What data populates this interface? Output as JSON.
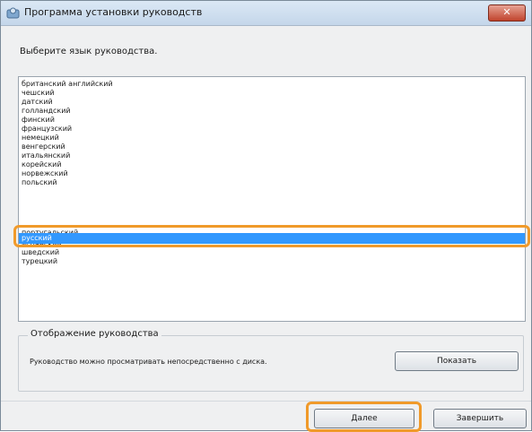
{
  "window": {
    "title": "Программа установки руководств",
    "close_label": "✕"
  },
  "instruction": "Выберите язык руководства.",
  "languages": [
    "британский английский",
    "чешский",
    "датский",
    "голландский",
    "финский",
    "французский",
    "немецкий",
    "венгерский",
    "итальянский",
    "корейский",
    "норвежский",
    "польский",
    "португальский",
    "русский",
    "испанский",
    "шведский",
    "турецкий"
  ],
  "selected_language": "русский",
  "display_group": {
    "title": "Отображение руководства",
    "text": "Руководство можно просматривать непосредственно с диска.",
    "show_label": "Показать"
  },
  "footer": {
    "next_label": "Далее",
    "finish_label": "Завершить"
  },
  "colors": {
    "selection": "#3298fe",
    "highlight_ring": "#f09a2a"
  }
}
